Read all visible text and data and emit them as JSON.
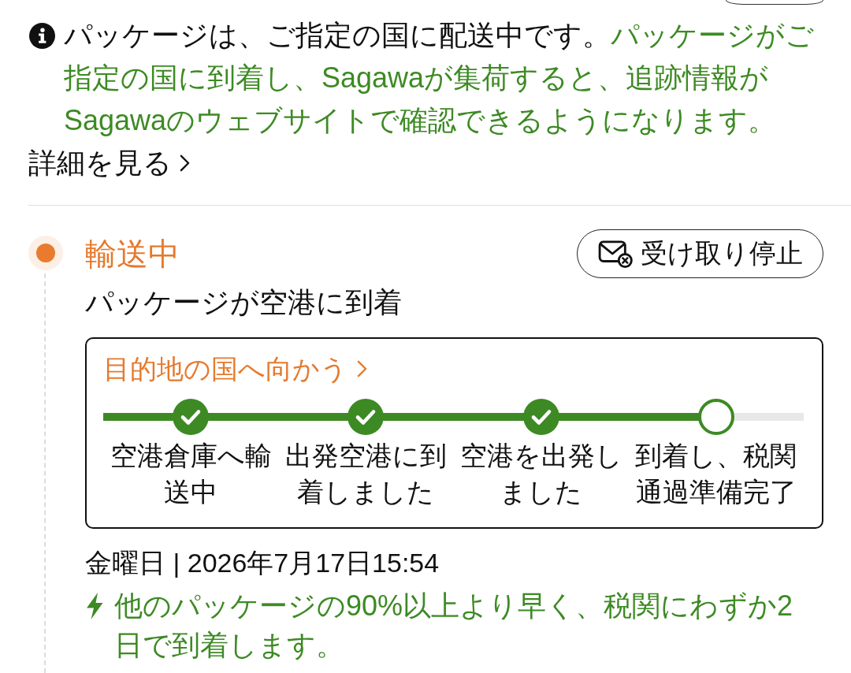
{
  "notice": {
    "lead": "パッケージは、ご指定の国に配送中です。",
    "detail": "パッケージがご指定の国に到着し、Sagawaが集荷すると、追跡情報がSagawaのウェブサイトで確認できるようになります。",
    "link": "詳細を見る"
  },
  "status": {
    "title": "輸送中",
    "action": "受け取り停止",
    "summary": "パッケージが空港に到着"
  },
  "progress_card": {
    "title": "目的地の国へ向かう",
    "steps": [
      {
        "label": "空港倉庫へ輸送中",
        "done": true
      },
      {
        "label": "出発空港に到着しました",
        "done": true
      },
      {
        "label": "空港を出発しました",
        "done": true
      },
      {
        "label": "到着し、税関通過準備完了",
        "done": false
      }
    ]
  },
  "delivery": {
    "date": "金曜日 | 2026年7月17日15:54",
    "eta_note": "他のパッケージの90%以上より早く、税関にわずか2日で到着します。"
  }
}
